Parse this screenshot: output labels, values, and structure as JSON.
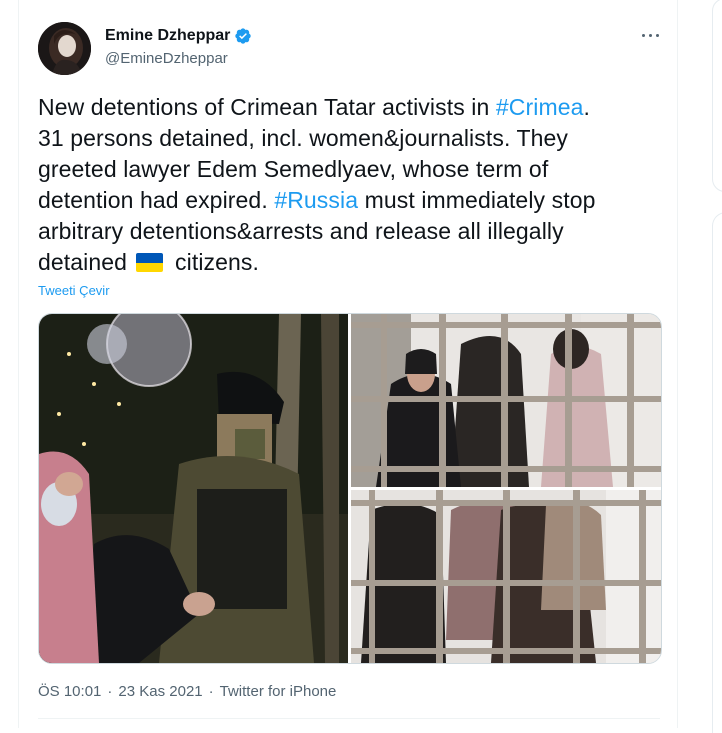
{
  "author": {
    "name": "Emine Dzheppar",
    "handle": "@EmineDzheppar",
    "verified": true
  },
  "tweet": {
    "lines": [
      [
        {
          "text": "New detentions of Crimean Tatar activists in "
        },
        {
          "text": "#Crimea",
          "hashtag": true
        },
        {
          "text": "."
        }
      ],
      [
        {
          "text": "31 persons detained, incl. women&journalists. They"
        }
      ],
      [
        {
          "text": "greeted lawyer Edem Semedlyaev, whose term of"
        }
      ],
      [
        {
          "text": "detention had expired. "
        },
        {
          "text": "#Russia",
          "hashtag": true
        },
        {
          "text": " must immediately stop"
        }
      ],
      [
        {
          "text": "arbitrary detentions&arrests and release all illegally"
        }
      ],
      [
        {
          "text": "detained "
        },
        {
          "emoji": "ukraine-flag"
        },
        {
          "text": " citizens."
        }
      ]
    ],
    "translate_label": "Tweeti Çevir"
  },
  "media": [
    {
      "description_icon": "photo-riot-police-arrest"
    },
    {
      "description_icon": "photo-women-behind-window-bars"
    },
    {
      "description_icon": "photo-people-behind-bars"
    }
  ],
  "meta": {
    "time": "ÖS 10:01",
    "separator": "·",
    "date": "23 Kas 2021",
    "source": "Twitter for iPhone"
  },
  "colors": {
    "link": "#1d9bf0",
    "text": "#0f1419",
    "secondary": "#536471",
    "flag_blue": "#0057b7",
    "flag_yellow": "#ffd700"
  }
}
